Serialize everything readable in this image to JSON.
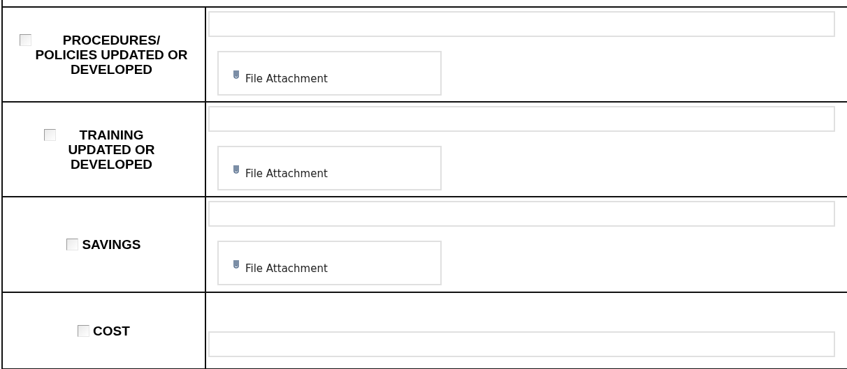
{
  "rows": [
    {
      "label": "PROCEDURES/ POLICIES UPDATED OR DEVELOPED",
      "checked": false,
      "kind": "attachment",
      "attachment": "File Attachment"
    },
    {
      "label": "TRAINING UPDATED OR DEVELOPED",
      "checked": false,
      "kind": "attachment",
      "attachment": "File Attachment"
    },
    {
      "label": "SAVINGS",
      "checked": false,
      "kind": "attachment",
      "attachment": "File Attachment"
    },
    {
      "label": "COST",
      "checked": false,
      "kind": "field"
    }
  ]
}
